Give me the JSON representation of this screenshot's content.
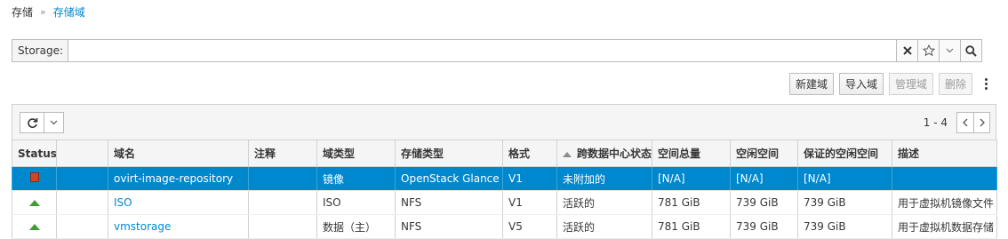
{
  "breadcrumb": {
    "parent": "存储",
    "separator": "»",
    "current": "存储域"
  },
  "search": {
    "label": "Storage:",
    "value": ""
  },
  "actions": {
    "new_domain": "新建域",
    "import_domain": "导入域",
    "manage_domain": "管理域",
    "remove": "删除"
  },
  "pager": {
    "range": "1 - 4"
  },
  "columns": [
    "Status",
    "",
    "域名",
    "注释",
    "域类型",
    "存储类型",
    "格式",
    "跨数据中心状态",
    "空间总量",
    "空闲空间",
    "保证的空闲空间",
    "描述"
  ],
  "rows": [
    {
      "status": "unattached-icon",
      "name": "ovirt-image-repository",
      "comment": "",
      "domain_type": "镜像",
      "storage_type": "OpenStack Glance",
      "format": "V1",
      "dc_status": "未附加的",
      "total": "[N/A]",
      "free": "[N/A]",
      "guaranteed": "[N/A]",
      "description": ""
    },
    {
      "status": "up-icon",
      "name": "ISO",
      "comment": "",
      "domain_type": "ISO",
      "storage_type": "NFS",
      "format": "V1",
      "dc_status": "活跃的",
      "total": "781 GiB",
      "free": "739 GiB",
      "guaranteed": "739 GiB",
      "description": "用于虚拟机镜像文件"
    },
    {
      "status": "up-icon",
      "name": "vmstorage",
      "comment": "",
      "domain_type": "数据（主）",
      "storage_type": "NFS",
      "format": "V5",
      "dc_status": "活跃的",
      "total": "781 GiB",
      "free": "739 GiB",
      "guaranteed": "739 GiB",
      "description": "用于虚拟机数据存储"
    }
  ],
  "colors": {
    "accent": "#0088ce",
    "up": "#3f9c35",
    "unattached": "#c8482f"
  }
}
